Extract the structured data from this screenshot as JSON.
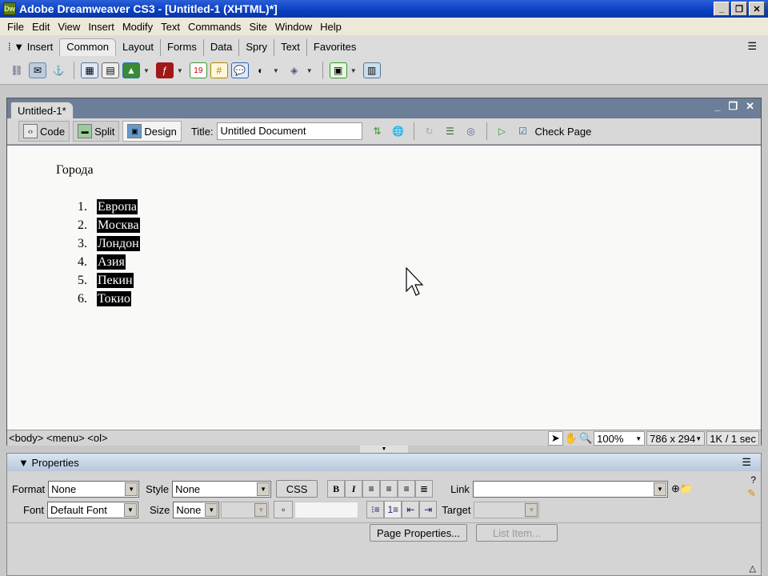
{
  "window": {
    "title": "Adobe Dreamweaver CS3 - [Untitled-1 (XHTML)*]",
    "logo": "Dw"
  },
  "menu": [
    "File",
    "Edit",
    "View",
    "Insert",
    "Modify",
    "Text",
    "Commands",
    "Site",
    "Window",
    "Help"
  ],
  "insert_bar": {
    "label": "Insert",
    "tabs": [
      "Common",
      "Layout",
      "Forms",
      "Data",
      "Spry",
      "Text",
      "Favorites"
    ],
    "active_tab": "Common"
  },
  "document": {
    "tab": "Untitled-1*",
    "views": {
      "code": "Code",
      "split": "Split",
      "design": "Design"
    },
    "title_label": "Title:",
    "title_value": "Untitled Document",
    "check_page": "Check Page"
  },
  "content": {
    "heading": "Города",
    "items": [
      {
        "num": "1.",
        "text": "Европа"
      },
      {
        "num": "2.",
        "text": "Москва"
      },
      {
        "num": "3.",
        "text": "Лондон"
      },
      {
        "num": "4.",
        "text": "Азия"
      },
      {
        "num": "5.",
        "text": "Пекин"
      },
      {
        "num": "6.",
        "text": "Токио"
      }
    ]
  },
  "status": {
    "tag_selector": "<body> <menu> <ol>",
    "zoom": "100%",
    "window_size": "786 x 294",
    "download": "1K / 1 sec"
  },
  "properties": {
    "title": "Properties",
    "format_label": "Format",
    "format": "None",
    "style_label": "Style",
    "style": "None",
    "css_button": "CSS",
    "bold": "B",
    "italic": "I",
    "link_label": "Link",
    "link": "",
    "font_label": "Font",
    "font": "Default Font",
    "size_label": "Size",
    "size": "None",
    "target_label": "Target",
    "page_properties": "Page Properties...",
    "list_item": "List Item..."
  }
}
